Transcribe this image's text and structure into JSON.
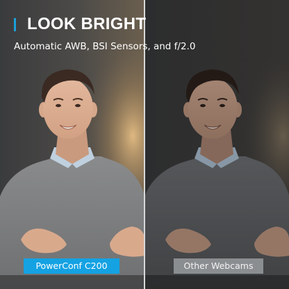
{
  "headline": {
    "title": "LOOK BRIGHT",
    "subtitle": "Automatic AWB, BSI Sensors, and f/2.0"
  },
  "labels": {
    "left": "PowerConf C200",
    "right": "Other Webcams"
  },
  "colors": {
    "accent": "#1c9fdc",
    "left_label_bg": "#14a2e3",
    "right_label_bg": "#8b8e91",
    "text": "#ffffff"
  }
}
